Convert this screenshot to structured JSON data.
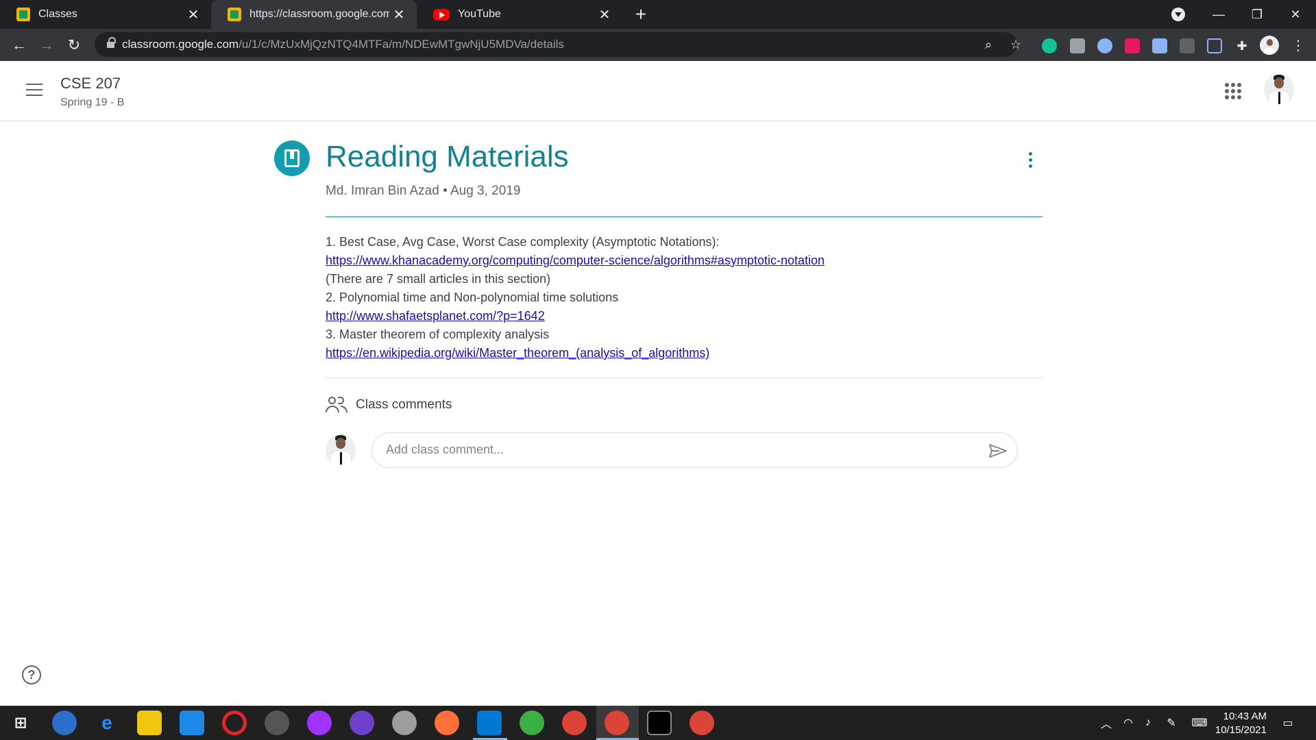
{
  "browser": {
    "tabs": [
      {
        "title": "Classes",
        "favicon": "classroom-icon",
        "active": false
      },
      {
        "title": "https://classroom.google.com/u/",
        "favicon": "classroom-icon",
        "active": true
      },
      {
        "title": "YouTube",
        "favicon": "youtube-icon",
        "active": false
      }
    ],
    "new_tab_label": "+",
    "url_host": "classroom.google.com",
    "url_path": "/u/1/c/MzUxMjQzNTQ4MTFa/m/NDEwMTgwNjU5MDVa/details"
  },
  "header": {
    "class_name": "CSE 207",
    "section": "Spring 19 - B"
  },
  "post": {
    "title": "Reading Materials",
    "author": "Md. Imran Bin Azad",
    "separator": "•",
    "date": "Aug 3, 2019",
    "lines": [
      {
        "type": "text",
        "value": "1. Best Case, Avg Case, Worst Case complexity (Asymptotic Notations):"
      },
      {
        "type": "link",
        "value": "https://www.khanacademy.org/computing/computer-science/algorithms#asymptotic-notation"
      },
      {
        "type": "text",
        "value": "(There are 7 small articles in this section)"
      },
      {
        "type": "text",
        "value": "2. Polynomial time and Non-polynomial time solutions"
      },
      {
        "type": "link",
        "value": "http://www.shafaetsplanet.com/?p=1642"
      },
      {
        "type": "text",
        "value": "3. Master theorem of complexity analysis"
      },
      {
        "type": "link",
        "value": "https://en.wikipedia.org/wiki/Master_theorem_(analysis_of_algorithms)"
      }
    ]
  },
  "comments": {
    "label": "Class comments",
    "placeholder": "Add class comment..."
  },
  "help": {
    "label": "?"
  },
  "taskbar": {
    "time": "10:43 AM",
    "date": "10/15/2021"
  },
  "colors": {
    "accent_teal": "#128293",
    "icon_teal": "#129eaf",
    "link": "#1a0dab"
  }
}
